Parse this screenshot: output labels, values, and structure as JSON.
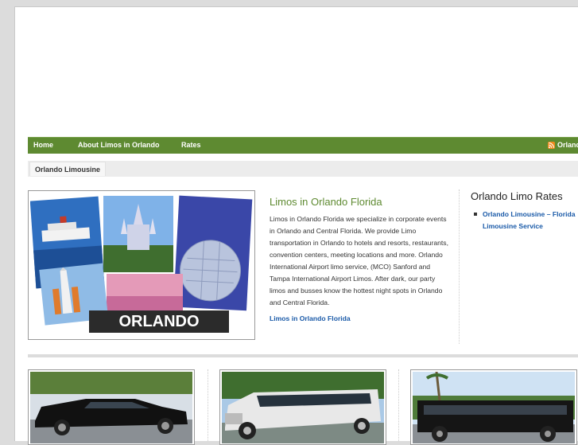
{
  "nav": {
    "items": [
      {
        "label": "Home"
      },
      {
        "label": "About Limos in Orlando"
      },
      {
        "label": "Rates"
      }
    ],
    "rss_label": "Orlando"
  },
  "breadcrumb": {
    "current": "Orlando Limousine"
  },
  "feature": {
    "image_caption": "ORLANDO",
    "title": "Limos in Orlando Florida",
    "body": "Limos in Orlando Florida we specialize in corporate events in Orlando and Central Florida. We provide Limo transportation in Orlando to hotels and resorts, restaurants, convention centers, meeting locations and more. Orlando International Airport limo service, (MCO) Sanford and Tampa International Airport Limos. After dark, our party limos and busses know the hottest night spots in Orlando and Central Florida.",
    "link": "Limos in Orlando Florida"
  },
  "sidebar": {
    "title": "Orlando Limo Rates",
    "links": [
      {
        "label": "Orlando Limousine – Florida Limousine Service"
      }
    ]
  },
  "colors": {
    "nav_green": "#5e8a31",
    "link_blue": "#1a5aa8",
    "title_green": "#5e8a31"
  }
}
